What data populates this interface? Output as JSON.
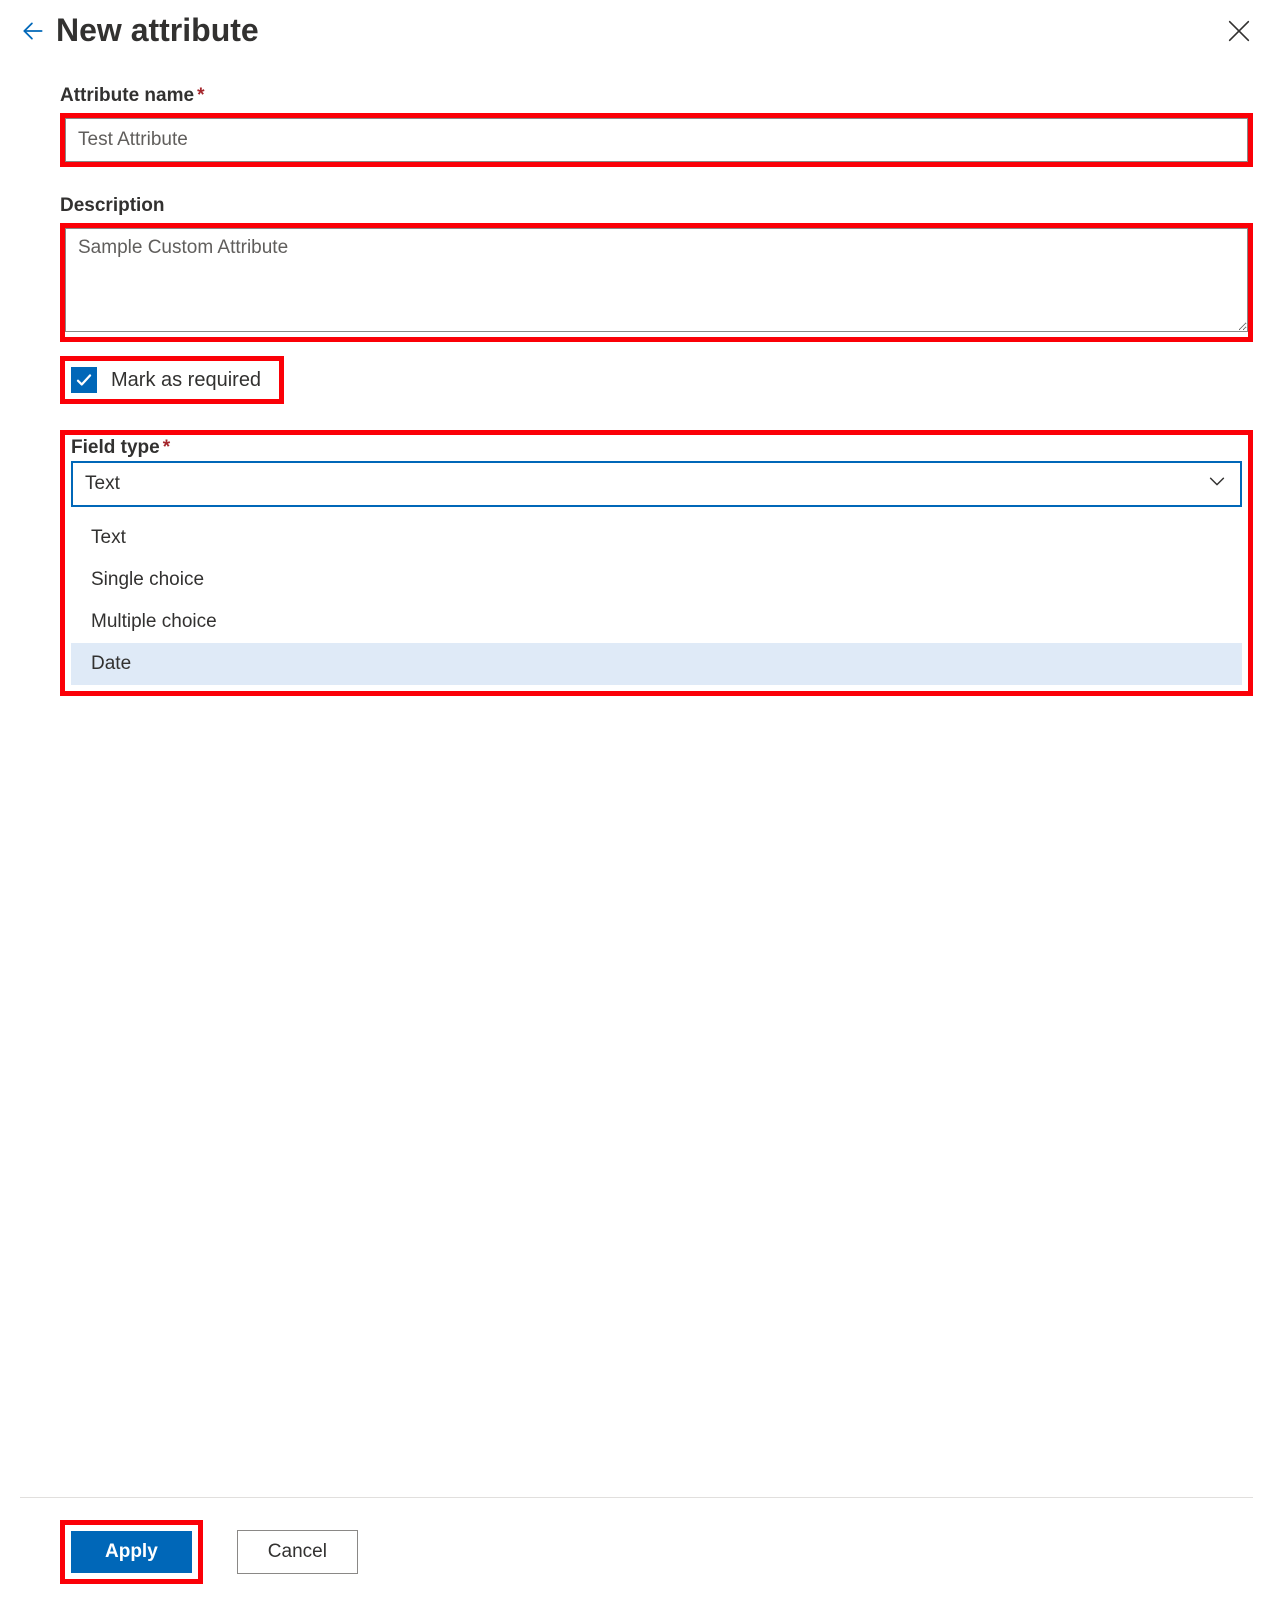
{
  "panel": {
    "title": "New attribute"
  },
  "fields": {
    "name": {
      "label": "Attribute name",
      "required": true,
      "value": "Test Attribute"
    },
    "description": {
      "label": "Description",
      "value": "Sample Custom Attribute"
    },
    "mark_required": {
      "label": "Mark as required",
      "checked": true
    },
    "field_type": {
      "label": "Field type",
      "required": true,
      "selected": "Text",
      "options": [
        "Text",
        "Single choice",
        "Multiple choice",
        "Date"
      ],
      "hovered_index": 3
    }
  },
  "footer": {
    "apply": "Apply",
    "cancel": "Cancel"
  },
  "colors": {
    "accent": "#0067b8",
    "highlight": "#fb0007"
  }
}
